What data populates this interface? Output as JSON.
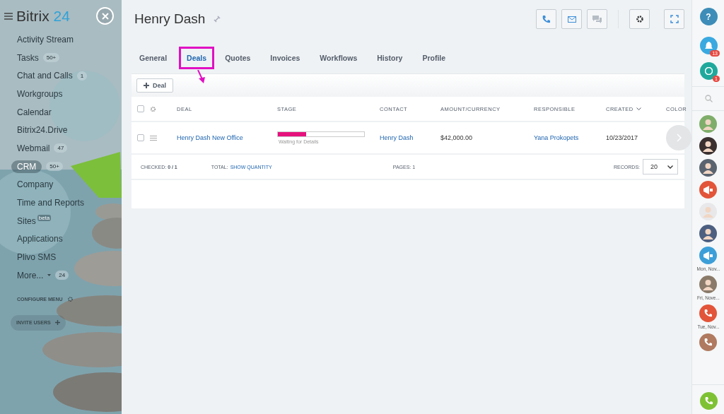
{
  "sidebar": {
    "logo": {
      "name": "Bitrix",
      "accent": "24"
    },
    "items": [
      {
        "label": "Activity Stream",
        "selected": false
      },
      {
        "label": "Tasks",
        "counter": "50+",
        "selected": false
      },
      {
        "label": "Chat and Calls",
        "counter": "1",
        "selected": false
      },
      {
        "label": "Workgroups",
        "selected": false
      },
      {
        "label": "Calendar",
        "selected": false
      },
      {
        "label": "Bitrix24.Drive",
        "selected": false
      },
      {
        "label": "Webmail",
        "counter": "47",
        "selected": false
      },
      {
        "label": "CRM",
        "counter": "50+",
        "selected": true
      },
      {
        "label": "Company",
        "selected": false
      },
      {
        "label": "Time and Reports",
        "selected": false
      },
      {
        "label": "Sites",
        "tag": "beta",
        "selected": false
      },
      {
        "label": "Applications",
        "selected": false
      },
      {
        "label": "Plivo SMS",
        "selected": false
      },
      {
        "label": "More...",
        "counter": "24",
        "dropdown": true,
        "selected": false
      }
    ],
    "configure": "CONFIGURE MENU",
    "invite": "INVITE USERS"
  },
  "page": {
    "title": "Henry Dash",
    "tabs": [
      {
        "label": "General",
        "selected": false
      },
      {
        "label": "Deals",
        "selected": true,
        "highlighted": true
      },
      {
        "label": "Quotes",
        "selected": false
      },
      {
        "label": "Invoices",
        "selected": false
      },
      {
        "label": "Workflows",
        "selected": false
      },
      {
        "label": "History",
        "selected": false
      },
      {
        "label": "Profile",
        "selected": false
      }
    ],
    "add_button": "Deal",
    "table": {
      "all_checked": false,
      "columns": [
        {
          "label": "DEAL"
        },
        {
          "label": "STAGE"
        },
        {
          "label": "CONTACT"
        },
        {
          "label": "AMOUNT/CURRENCY"
        },
        {
          "label": "RESPONSIBLE"
        },
        {
          "label": "CREATED",
          "sorted": true
        },
        {
          "label": "COLOR"
        }
      ],
      "rows": [
        {
          "checked": false,
          "deal": "Henry Dash New Office",
          "stage": {
            "level": 0.33,
            "label": "Waiting for Details"
          },
          "contact": "Henry Dash",
          "amount": "$42,000.00",
          "responsible": "Yana Prokopets",
          "created": "10/23/2017"
        }
      ]
    },
    "footer": {
      "checked_label": "CHECKED:",
      "checked_value": "0 / 1",
      "total_label": "TOTAL:",
      "total_link": "SHOW QUANTITY",
      "pages_label": "PAGES:",
      "pages_value": "1",
      "records_label": "RECORDS:",
      "records_value": "20"
    }
  },
  "right_bar": {
    "help": "?",
    "notifications": "13",
    "messages": "1",
    "contacts": [
      {
        "kind": "avatar",
        "color": "#7fae6a"
      },
      {
        "kind": "avatar",
        "color": "#3a3030"
      },
      {
        "kind": "avatar",
        "color": "#5a6470"
      },
      {
        "kind": "megaphone",
        "color": "#e2553a"
      },
      {
        "kind": "avatar",
        "color": "#e8e8ea"
      },
      {
        "kind": "avatar",
        "color": "#4d5f80"
      },
      {
        "kind": "megaphone",
        "color": "#3d9fd8",
        "caption": "Mon, Nov..."
      },
      {
        "kind": "avatar",
        "color": "#8a7a6a",
        "caption": "Fri, Nove..."
      },
      {
        "kind": "phone",
        "color": "#e2553a",
        "caption": "Tue, Nov..."
      },
      {
        "kind": "phone",
        "color": "#b07a60"
      }
    ]
  }
}
